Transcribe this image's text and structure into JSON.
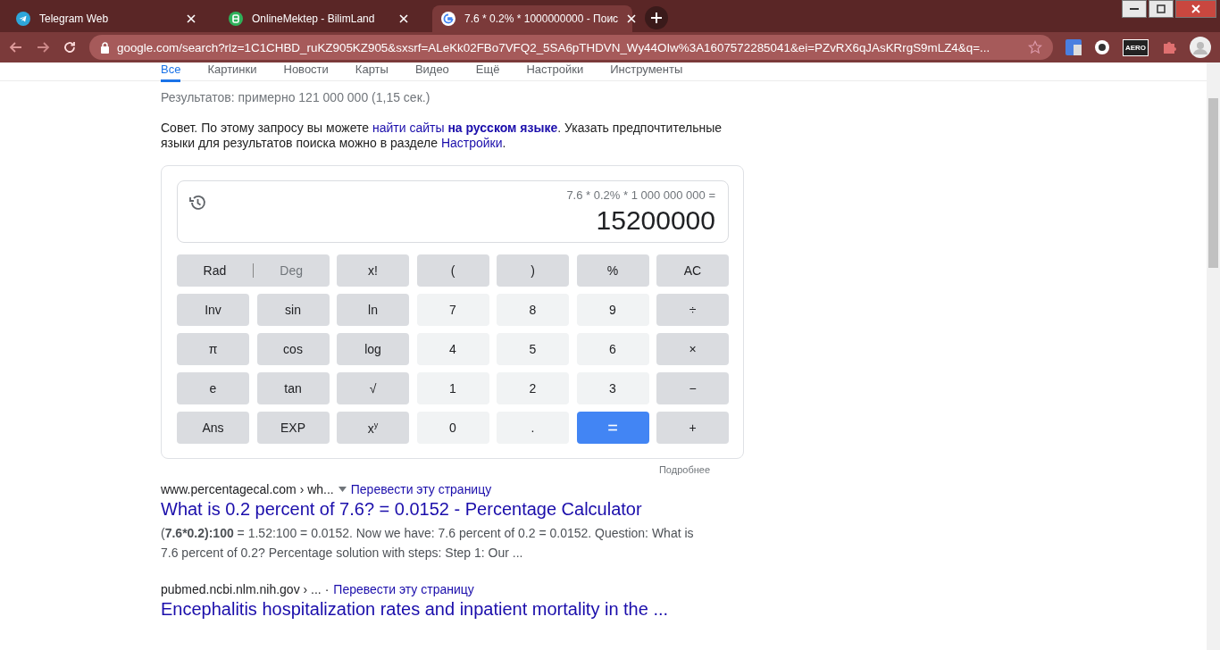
{
  "browser": {
    "tabs": [
      {
        "title": "Telegram Web",
        "selected": false
      },
      {
        "title": "OnlineMektep - BilimLand",
        "selected": false
      },
      {
        "title": "7.6 * 0.2% * 1000000000 - Поис",
        "selected": true
      }
    ],
    "url": "google.com/search?rlz=1C1CHBD_ruKZ905KZ905&sxsrf=ALeKk02FBo7VFQ2_5SA6pTHDVN_Wy44OIw%3A1607572285041&ei=PZvRX6qJAsKRrgS9mLZ4&q=...",
    "extension_badge": "AERO"
  },
  "nav": [
    {
      "label": "Все",
      "selected": true
    },
    {
      "label": "Картинки",
      "selected": false
    },
    {
      "label": "Новости",
      "selected": false
    },
    {
      "label": "Карты",
      "selected": false
    },
    {
      "label": "Видео",
      "selected": false
    },
    {
      "label": "Ещё",
      "selected": false
    },
    {
      "label": "Настройки",
      "selected": false
    },
    {
      "label": "Инструменты",
      "selected": false
    }
  ],
  "result_stats": "Результатов: примерно 121 000 000 (1,15 сек.)",
  "tip": [
    {
      "text": "Совет. По этому запросу вы можете ",
      "kind": "text"
    },
    {
      "text": "найти сайты **на русском языке**",
      "kind": "link"
    },
    {
      "text": ". Указать предпочтительные языки для результатов поиска можно в разделе ",
      "kind": "text"
    },
    {
      "text": "Настройки",
      "kind": "link"
    },
    {
      "text": ".",
      "kind": "text"
    }
  ],
  "calculator": {
    "expression": "7.6 * 0.2% * 1 000 000 000 =",
    "result": "15200000",
    "more": "Подробнее",
    "keys": [
      {
        "kind": "toggle",
        "options": [
          {
            "label": "Rad",
            "selected": true
          },
          {
            "label": "Deg",
            "selected": false
          }
        ]
      },
      {
        "kind": "fn",
        "label": "x!"
      },
      {
        "kind": "fn",
        "label": "("
      },
      {
        "kind": "fn",
        "label": ")"
      },
      {
        "kind": "fn",
        "label": "%"
      },
      {
        "kind": "fn",
        "label": "AC"
      },
      {
        "kind": "fn",
        "label": "Inv"
      },
      {
        "kind": "fn",
        "label": "sin"
      },
      {
        "kind": "fn",
        "label": "ln"
      },
      {
        "kind": "num",
        "label": "7"
      },
      {
        "kind": "num",
        "label": "8"
      },
      {
        "kind": "num",
        "label": "9"
      },
      {
        "kind": "fn",
        "label": "÷"
      },
      {
        "kind": "fn",
        "label": "π"
      },
      {
        "kind": "fn",
        "label": "cos"
      },
      {
        "kind": "fn",
        "label": "log"
      },
      {
        "kind": "num",
        "label": "4"
      },
      {
        "kind": "num",
        "label": "5"
      },
      {
        "kind": "num",
        "label": "6"
      },
      {
        "kind": "fn",
        "label": "×"
      },
      {
        "kind": "fn",
        "label": "e"
      },
      {
        "kind": "fn",
        "label": "tan"
      },
      {
        "kind": "fn",
        "label": "√"
      },
      {
        "kind": "num",
        "label": "1"
      },
      {
        "kind": "num",
        "label": "2"
      },
      {
        "kind": "num",
        "label": "3"
      },
      {
        "kind": "fn",
        "label": "−"
      },
      {
        "kind": "fn",
        "label": "Ans"
      },
      {
        "kind": "fn",
        "label": "EXP"
      },
      {
        "kind": "fn",
        "label": "x$^{y}$"
      },
      {
        "kind": "num",
        "label": "0"
      },
      {
        "kind": "num",
        "label": "."
      },
      {
        "kind": "equals",
        "label": "="
      },
      {
        "kind": "fn",
        "label": "+"
      }
    ]
  },
  "results": [
    {
      "site": "www.percentagecal.com › wh...",
      "menu": true,
      "translate": "Перевести эту страницу",
      "title": "What is 0.2 percent of 7.6? = 0.0152 - Percentage Calculator",
      "snippet": "(**7.6*0.2):100** = 1.52:100 = 0.0152. Now we have: 7.6 percent of 0.2 = 0.0152. Question: What is 7.6 percent of 0.2? Percentage solution with steps: Step 1: Our ..."
    },
    {
      "site": "pubmed.ncbi.nlm.nih.gov › ... ·",
      "menu": false,
      "translate": "Перевести эту страницу",
      "title": "Encephalitis hospitalization rates and inpatient mortality in the ..."
    }
  ]
}
